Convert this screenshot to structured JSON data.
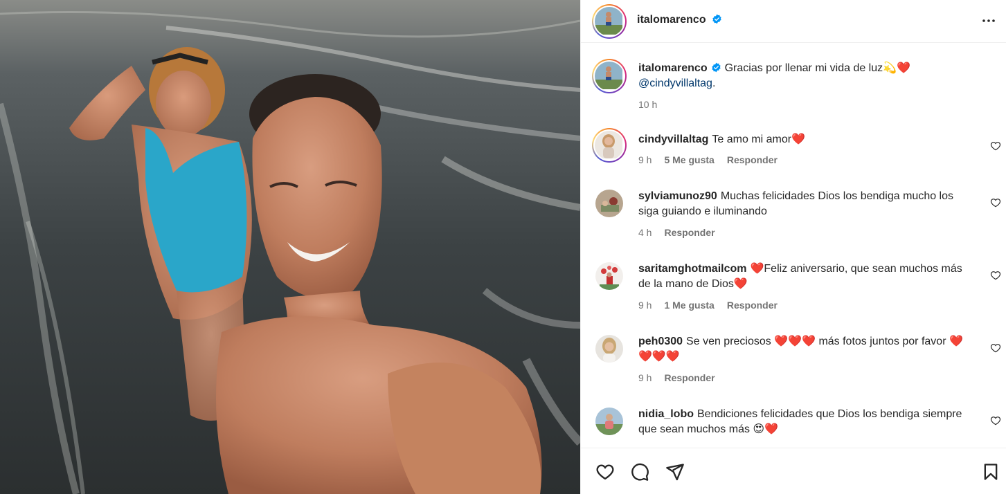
{
  "post": {
    "author": "italomarenco",
    "caption": "Gracias por llenar mi vida de luz💫❤️",
    "caption_mention": "@cindyvillaltag",
    "caption_end": ".",
    "caption_time": "10 h"
  },
  "comments": [
    {
      "user": "cindyvillaltag",
      "text": "Te amo mi amor❤️",
      "time": "9 h",
      "likes": "5 Me gusta",
      "reply": "Responder"
    },
    {
      "user": "sylviamunoz90",
      "text": "Muchas felicidades Dios los bendiga mucho los siga guiando e iluminando",
      "time": "4 h",
      "likes": "",
      "reply": "Responder"
    },
    {
      "user": "saritamghotmailcom",
      "text": "❤️Feliz aniversario, que sean muchos más de la mano de Dios❤️",
      "time": "9 h",
      "likes": "1 Me gusta",
      "reply": "Responder"
    },
    {
      "user": "peh0300",
      "text": "Se ven preciosos ❤️❤️❤️ más fotos juntos por favor ❤️❤️❤️❤️",
      "time": "9 h",
      "likes": "",
      "reply": "Responder"
    },
    {
      "user": "nidia_lobo",
      "text": "Bendiciones felicidades que Dios los bendiga siempre que sean muchos más 😍❤️",
      "time": "",
      "likes": "",
      "reply": ""
    }
  ],
  "icons": {
    "more": "more-options-icon",
    "verified": "verified-badge-icon",
    "like": "heart-icon",
    "comment": "comment-icon",
    "share": "share-icon",
    "save": "bookmark-icon"
  },
  "colors": {
    "verified": "#0095f6",
    "link": "#00376b",
    "muted": "#737373",
    "text": "#262626"
  }
}
